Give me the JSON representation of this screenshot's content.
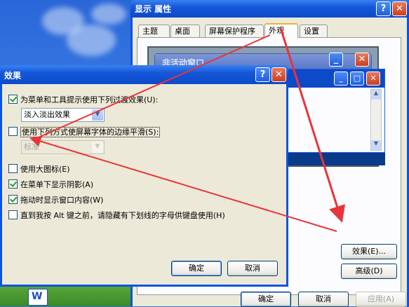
{
  "display_props": {
    "title": "显示 属性",
    "help_label": "?",
    "close_label": "✕",
    "tabs": [
      "主题",
      "桌面",
      "屏幕保护程序",
      "外观",
      "设置"
    ],
    "active_tab": "外观",
    "preview_inactive_title": "非活动窗口",
    "effects_button": "效果(E)...",
    "advanced_button": "高级(D)",
    "ok_button": "确定",
    "cancel_button": "取消",
    "apply_button": "应用(A)"
  },
  "effects_dialog": {
    "title": "效果",
    "help_label": "?",
    "close_label": "✕",
    "opt_transition": {
      "label": "为菜单和工具提示使用下列过渡效果(U):",
      "checked": true
    },
    "transition_value": "淡入淡出效果",
    "opt_smooth": {
      "label": "使用下列方式使屏幕字体的边缘平滑(S):",
      "checked": false
    },
    "smooth_value": "标准",
    "opt_large_icons": {
      "label": "使用大图标(E)",
      "checked": false
    },
    "opt_menu_shadow": {
      "label": "在菜单下显示阴影(A)",
      "checked": true
    },
    "opt_drag_contents": {
      "label": "拖动时显示窗口内容(W)",
      "checked": true
    },
    "opt_hide_underline": {
      "label": "直到我按 Alt 键之前，请隐藏有下划线的字母供键盘使用(H)",
      "checked": false
    },
    "ok_button": "确定",
    "cancel_button": "取消"
  },
  "desktop": {
    "icon_letter": "W"
  },
  "colors": {
    "title_blue": "#0c4ac8",
    "dialog_face": "#ece9d8",
    "arrow_red": "#e8343a"
  }
}
